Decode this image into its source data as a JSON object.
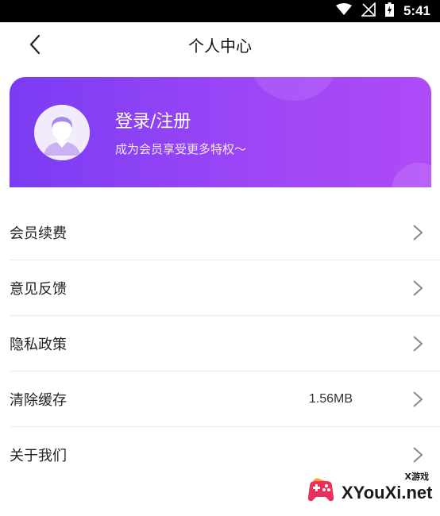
{
  "status_bar": {
    "time": "5:41",
    "icons": [
      "wifi-icon",
      "signal-off-icon",
      "battery-charging-icon"
    ]
  },
  "header": {
    "title": "个人中心",
    "back_icon": "chevron-left-icon"
  },
  "profile": {
    "title": "登录/注册",
    "subtitle": "成为会员享受更多特权～",
    "avatar_icon": "default-avatar-icon",
    "gradient_colors": [
      "#7a3cf3",
      "#b04af7"
    ]
  },
  "menu": {
    "items": [
      {
        "label": "会员续费"
      },
      {
        "label": "意见反馈"
      },
      {
        "label": "隐私政策"
      },
      {
        "label": "清除缓存",
        "value": "1.56MB"
      },
      {
        "label": "关于我们"
      }
    ],
    "chevron_icon": "chevron-right-icon"
  },
  "watermark": {
    "text": "XYouXi.net",
    "tag": "X游戏"
  }
}
